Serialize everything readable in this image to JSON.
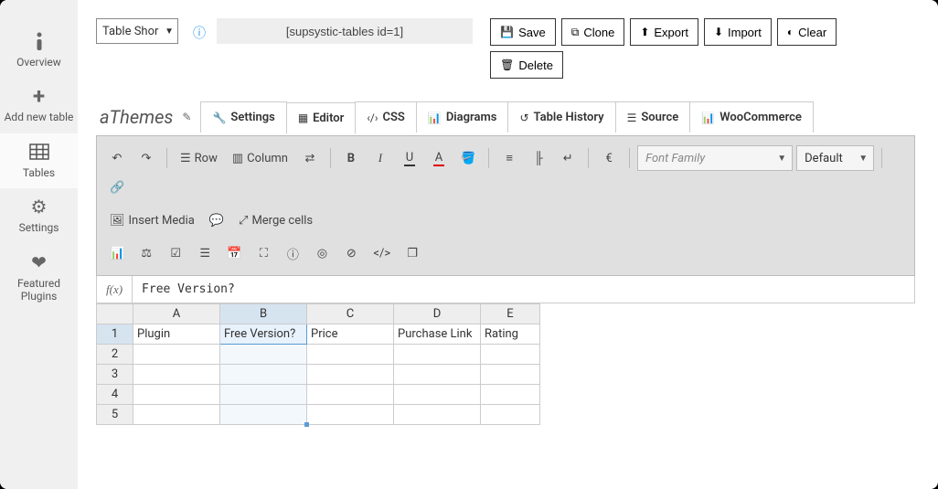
{
  "sidebar": {
    "items": [
      {
        "label": "Overview",
        "icon": "info"
      },
      {
        "label": "Add new table",
        "icon": "plus"
      },
      {
        "label": "Tables",
        "icon": "grid"
      },
      {
        "label": "Settings",
        "icon": "gear"
      },
      {
        "label": "Featured Plugins",
        "icon": "heart"
      }
    ]
  },
  "top": {
    "type_select": "Table Shor",
    "shortcode": "[supsystic-tables id=1]",
    "buttons": {
      "save": "Save",
      "clone": "Clone",
      "export": "Export",
      "import": "Import",
      "clear": "Clear",
      "delete": "Delete"
    }
  },
  "title": "aThemes",
  "tabs": [
    {
      "label": "Settings",
      "icon": "wrench"
    },
    {
      "label": "Editor",
      "icon": "grid"
    },
    {
      "label": "CSS",
      "icon": "code"
    },
    {
      "label": "Diagrams",
      "icon": "chart"
    },
    {
      "label": "Table History",
      "icon": "history"
    },
    {
      "label": "Source",
      "icon": "stack"
    },
    {
      "label": "WooCommerce",
      "icon": "chart"
    }
  ],
  "toolbar": {
    "row": "Row",
    "column": "Column",
    "font_family": "Font Family",
    "font_size": "Default",
    "insert_media": "Insert Media",
    "merge_cells": "Merge cells"
  },
  "formula": {
    "label": "f(x)",
    "value": "Free Version?"
  },
  "sheet": {
    "columns": [
      "A",
      "B",
      "C",
      "D",
      "E"
    ],
    "rows": [
      "1",
      "2",
      "3",
      "4",
      "5"
    ],
    "data": [
      [
        "Plugin",
        "Free Version?",
        "Price",
        "Purchase Link",
        "Rating"
      ],
      [
        "",
        "",
        "",
        "",
        ""
      ],
      [
        "",
        "",
        "",
        "",
        ""
      ],
      [
        "",
        "",
        "",
        "",
        ""
      ],
      [
        "",
        "",
        "",
        "",
        ""
      ]
    ],
    "selected": {
      "col": 1,
      "row": 0
    }
  }
}
